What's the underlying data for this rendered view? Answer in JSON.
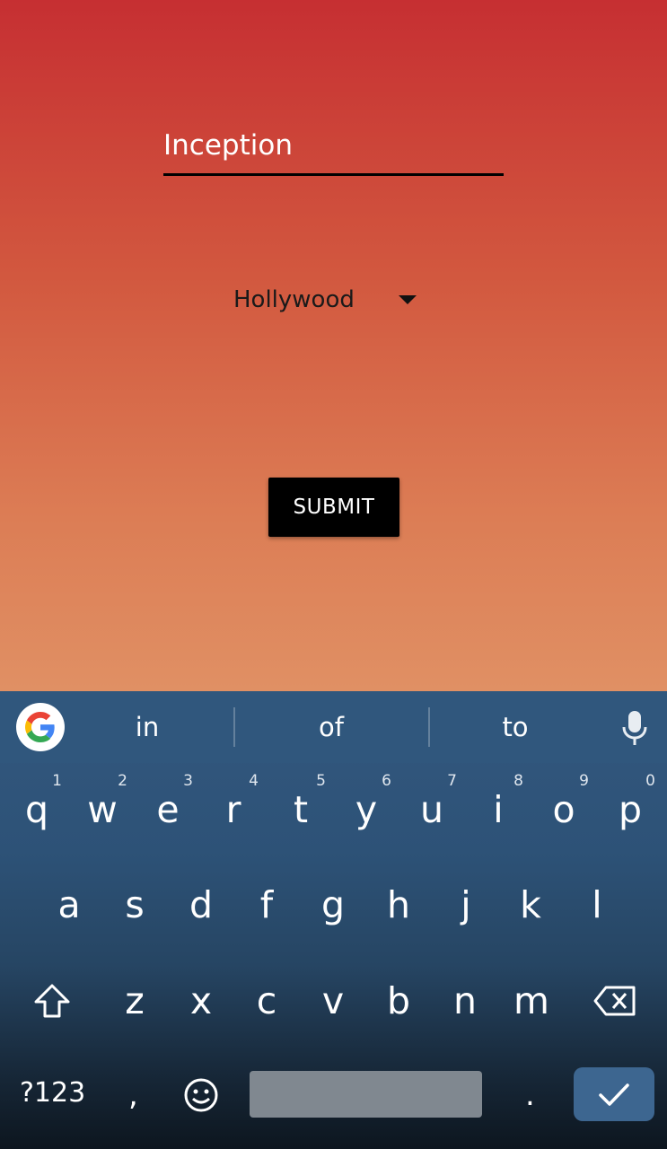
{
  "form": {
    "movie_value": "Inception",
    "industry_selected": "Hollywood",
    "submit_label": "SUBMIT"
  },
  "keyboard": {
    "suggestions": [
      "in",
      "of",
      "to"
    ],
    "row1": [
      {
        "key": "q",
        "hint": "1"
      },
      {
        "key": "w",
        "hint": "2"
      },
      {
        "key": "e",
        "hint": "3"
      },
      {
        "key": "r",
        "hint": "4"
      },
      {
        "key": "t",
        "hint": "5"
      },
      {
        "key": "y",
        "hint": "6"
      },
      {
        "key": "u",
        "hint": "7"
      },
      {
        "key": "i",
        "hint": "8"
      },
      {
        "key": "o",
        "hint": "9"
      },
      {
        "key": "p",
        "hint": "0"
      }
    ],
    "row2": [
      "a",
      "s",
      "d",
      "f",
      "g",
      "h",
      "j",
      "k",
      "l"
    ],
    "row3": [
      "z",
      "x",
      "c",
      "v",
      "b",
      "n",
      "m"
    ],
    "symbols_label": "?123",
    "comma_label": ",",
    "period_label": ".",
    "icons": [
      "google-icon",
      "mic-icon",
      "shift-icon",
      "backspace-icon",
      "emoji-icon",
      "check-icon"
    ]
  },
  "colors": {
    "gradient_top": "#c62f32",
    "gradient_bottom": "#e09064",
    "keyboard_bg": "#2d5277",
    "enter_key": "#3d6690"
  }
}
